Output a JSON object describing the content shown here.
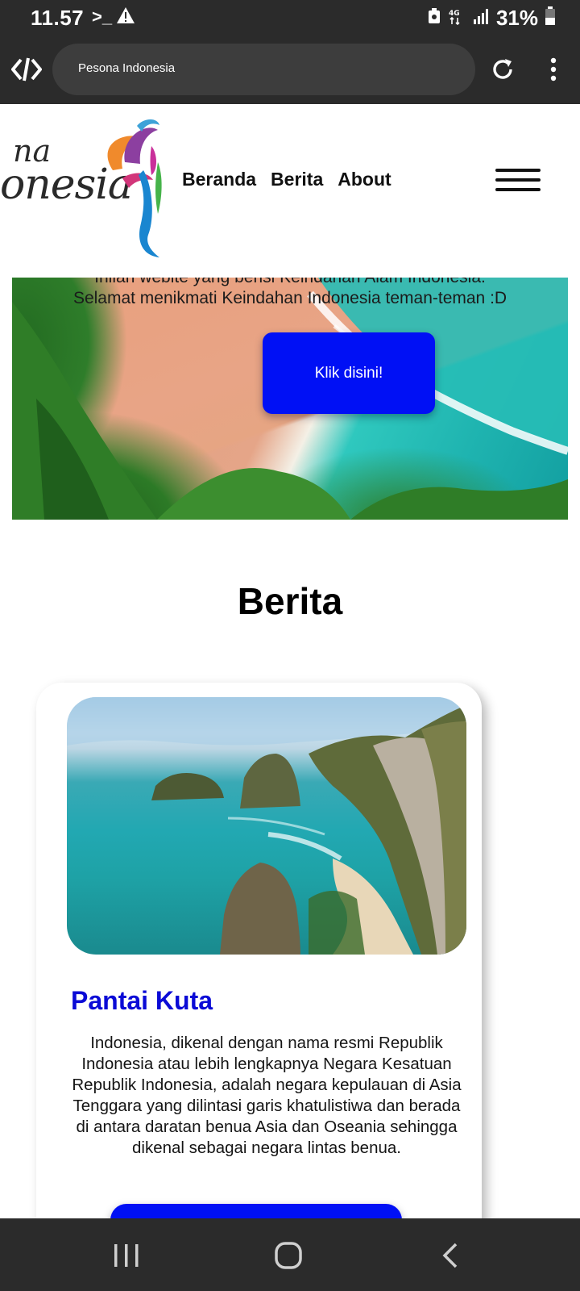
{
  "status_bar": {
    "time": "11.57",
    "terminal_icon": "terminal-icon",
    "warning_icon": "warning-icon",
    "network": "4G",
    "battery_percent": "31%"
  },
  "browser": {
    "url_title": "Pesona Indonesia",
    "reload_icon": "reload-icon",
    "menu_icon": "more-vert-icon"
  },
  "site": {
    "logo_word1": "na",
    "logo_word2": "onesia",
    "nav": [
      "Beranda",
      "Berita",
      "About"
    ],
    "hamburger_icon": "hamburger-icon"
  },
  "hero": {
    "line1": "Inilah webite yang berisi Keindahan Alam Indonesia.",
    "line2": "Selamat menikmati Keindahan Indonesia teman-teman :D",
    "button": "Klik disini!"
  },
  "berita": {
    "section_title": "Berita",
    "cards": [
      {
        "title": "Pantai Kuta",
        "text": "Indonesia, dikenal dengan nama resmi Republik Indonesia atau lebih lengkapnya Negara Kesatuan Republik Indonesia, adalah negara kepulauan di Asia Tenggara yang dilintasi garis khatulistiwa dan berada di antara daratan benua Asia dan Oseania sehingga dikenal sebagai negara lintas benua."
      }
    ]
  },
  "colors": {
    "accent_blue": "#0010f5",
    "title_blue": "#0b0bd6",
    "system_bar": "#2b2b2b"
  }
}
